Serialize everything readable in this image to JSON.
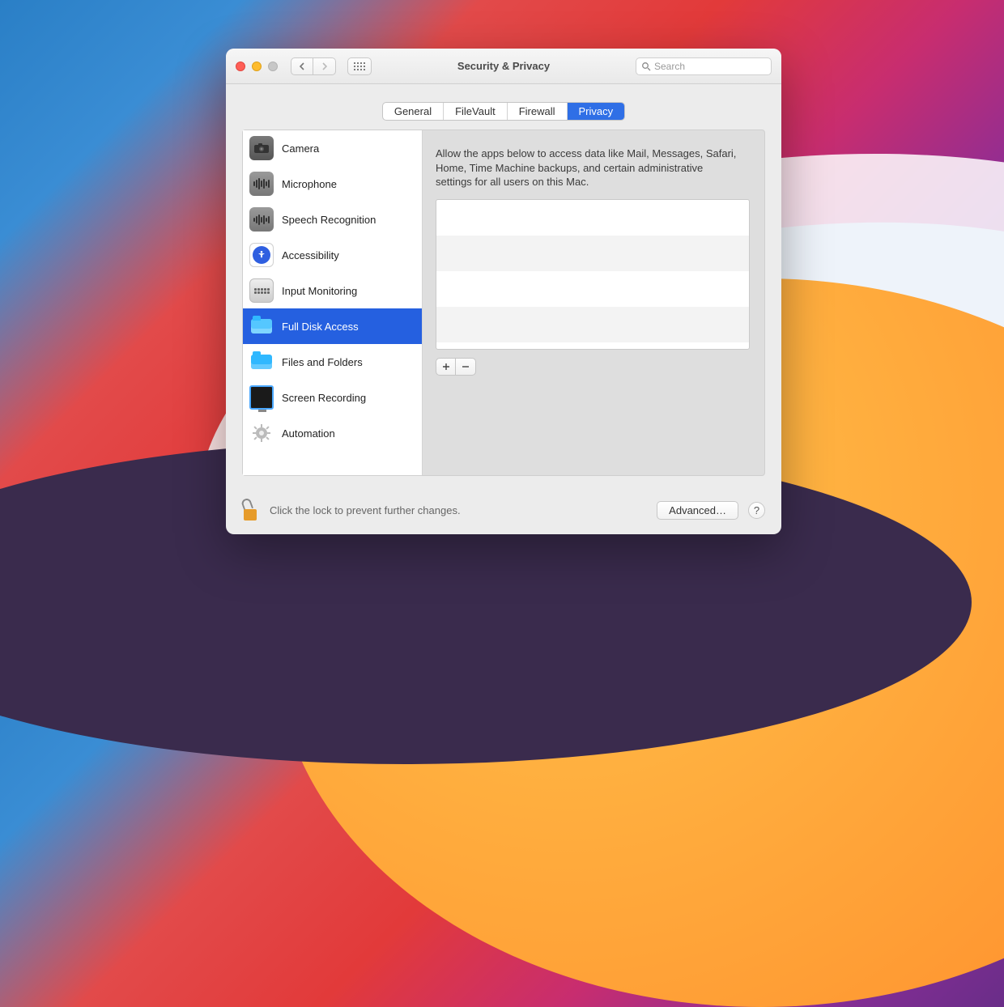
{
  "window": {
    "title": "Security & Privacy"
  },
  "search": {
    "placeholder": "Search"
  },
  "tabs": [
    "General",
    "FileVault",
    "Firewall",
    "Privacy"
  ],
  "active_tab": "Privacy",
  "sidebar": {
    "items": [
      {
        "label": "Camera"
      },
      {
        "label": "Microphone"
      },
      {
        "label": "Speech Recognition"
      },
      {
        "label": "Accessibility"
      },
      {
        "label": "Input Monitoring"
      },
      {
        "label": "Full Disk Access"
      },
      {
        "label": "Files and Folders"
      },
      {
        "label": "Screen Recording"
      },
      {
        "label": "Automation"
      }
    ],
    "selected_index": 5
  },
  "detail": {
    "description": "Allow the apps below to access data like Mail, Messages, Safari, Home, Time Machine backups, and certain administrative settings for all users on this Mac."
  },
  "footer": {
    "lock_text": "Click the lock to prevent further changes.",
    "advanced": "Advanced…",
    "help": "?"
  }
}
